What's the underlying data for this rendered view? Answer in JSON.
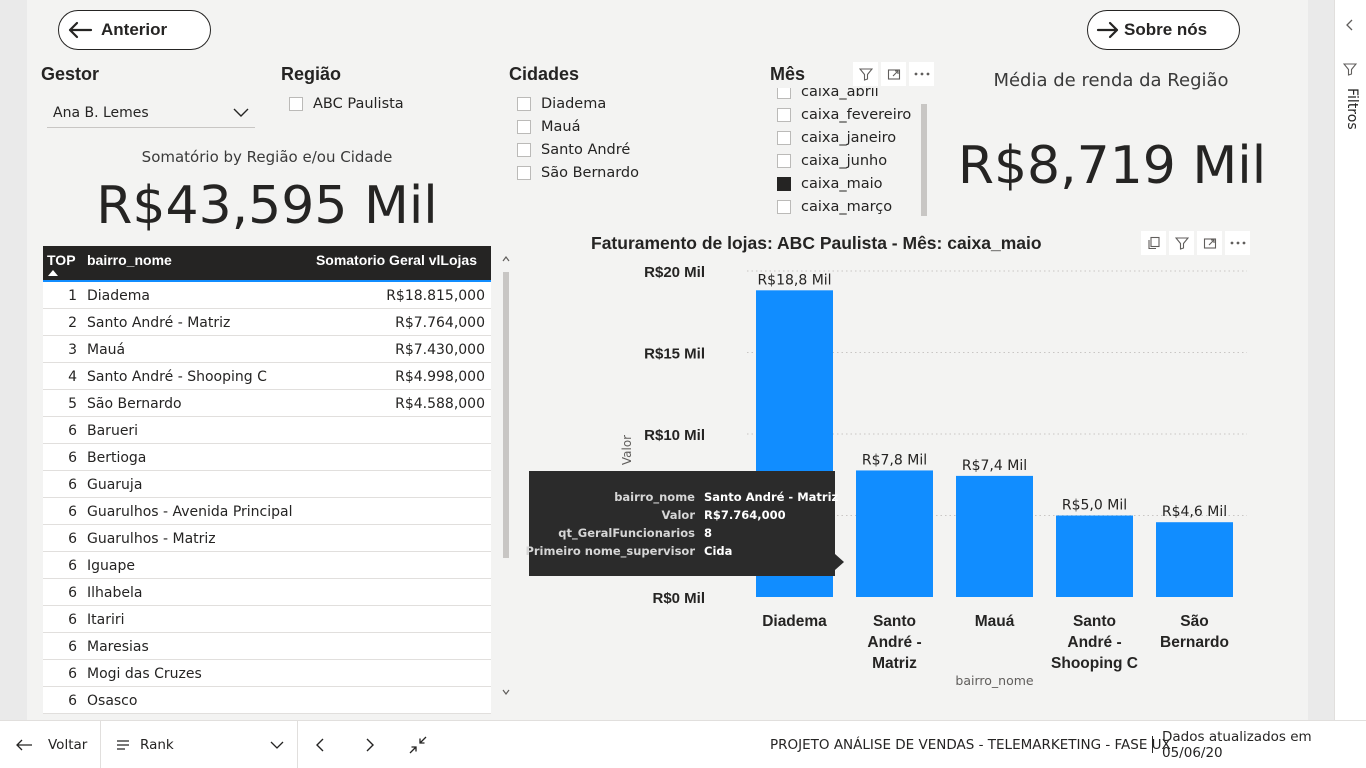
{
  "nav": {
    "back_label": "Anterior",
    "about_label": "Sobre nós"
  },
  "gestor": {
    "title": "Gestor",
    "selected": "Ana B. Lemes"
  },
  "regiao": {
    "title": "Região",
    "options": [
      {
        "label": "ABC Paulista",
        "checked": false
      }
    ]
  },
  "cidades": {
    "title": "Cidades",
    "options": [
      {
        "label": "Diadema",
        "checked": false
      },
      {
        "label": "Mauá",
        "checked": false
      },
      {
        "label": "Santo André",
        "checked": false
      },
      {
        "label": "São Bernardo",
        "checked": false
      }
    ]
  },
  "mes": {
    "title": "Mês",
    "options": [
      {
        "label": "caixa_abril",
        "checked": false
      },
      {
        "label": "caixa_fevereiro",
        "checked": false
      },
      {
        "label": "caixa_janeiro",
        "checked": false
      },
      {
        "label": "caixa_junho",
        "checked": false
      },
      {
        "label": "caixa_maio",
        "checked": true
      },
      {
        "label": "caixa_março",
        "checked": false
      }
    ]
  },
  "cards": {
    "soma": {
      "label": "Somatório by Região e/ou Cidade",
      "value": "R$43,595 Mil"
    },
    "media": {
      "label": "Média de renda da Região",
      "value": "R$8,719 Mil"
    }
  },
  "table": {
    "headers": {
      "top": "TOP",
      "nome": "bairro_nome",
      "valor": "Somatorio Geral vlLojas"
    },
    "rows": [
      {
        "top": "1",
        "nome": "Diadema",
        "valor": "R$18.815,000"
      },
      {
        "top": "2",
        "nome": "Santo André - Matriz",
        "valor": "R$7.764,000"
      },
      {
        "top": "3",
        "nome": "Mauá",
        "valor": "R$7.430,000"
      },
      {
        "top": "4",
        "nome": "Santo André - Shooping C",
        "valor": "R$4.998,000"
      },
      {
        "top": "5",
        "nome": "São Bernardo",
        "valor": "R$4.588,000"
      },
      {
        "top": "6",
        "nome": "Barueri",
        "valor": ""
      },
      {
        "top": "6",
        "nome": "Bertioga",
        "valor": ""
      },
      {
        "top": "6",
        "nome": "Guaruja",
        "valor": ""
      },
      {
        "top": "6",
        "nome": "Guarulhos - Avenida Principal",
        "valor": ""
      },
      {
        "top": "6",
        "nome": "Guarulhos - Matriz",
        "valor": ""
      },
      {
        "top": "6",
        "nome": "Iguape",
        "valor": ""
      },
      {
        "top": "6",
        "nome": "Ilhabela",
        "valor": ""
      },
      {
        "top": "6",
        "nome": "Itariri",
        "valor": ""
      },
      {
        "top": "6",
        "nome": "Maresias",
        "valor": ""
      },
      {
        "top": "6",
        "nome": "Mogi das Cruzes",
        "valor": ""
      },
      {
        "top": "6",
        "nome": "Osasco",
        "valor": ""
      }
    ]
  },
  "chart_data": {
    "type": "bar",
    "title": "Faturamento de lojas: ABC Paulista - Mês: caixa_maio",
    "xlabel": "bairro_nome",
    "ylabel": "Valor",
    "ylim": [
      0,
      20
    ],
    "yticks": [
      {
        "value": 0,
        "label": "R$0 Mil"
      },
      {
        "value": 5,
        "label": ""
      },
      {
        "value": 10,
        "label": "R$10 Mil"
      },
      {
        "value": 15,
        "label": "R$15 Mil"
      },
      {
        "value": 20,
        "label": "R$20 Mil"
      }
    ],
    "grid": true,
    "bar_color": "#118dff",
    "categories": [
      "Diadema",
      "Santo André - Matriz",
      "Mauá",
      "Santo André - Shooping C",
      "São Bernardo"
    ],
    "category_lines": [
      [
        "Diadema"
      ],
      [
        "Santo",
        "André -",
        "Matriz"
      ],
      [
        "Mauá"
      ],
      [
        "Santo",
        "André -",
        "Shooping C"
      ],
      [
        "São",
        "Bernardo"
      ]
    ],
    "values": [
      18.815,
      7.764,
      7.43,
      4.998,
      4.588
    ],
    "data_labels": [
      "R$18,8 Mil",
      "R$7,8 Mil",
      "R$7,4 Mil",
      "R$5,0 Mil",
      "R$4,6 Mil"
    ]
  },
  "tooltip": {
    "rows": [
      {
        "key": "bairro_nome",
        "value": "Santo André - Matriz"
      },
      {
        "key": "Valor",
        "value": "R$7.764,000"
      },
      {
        "key": "qt_GeralFuncionarios",
        "value": "8"
      },
      {
        "key": "Primeiro nome_supervisor",
        "value": "Cida"
      }
    ]
  },
  "statusbar": {
    "back_label": "Voltar",
    "page_label": "Rank",
    "footer_text": "PROJETO ANÁLISE DE VENDAS - TELEMARKETING - FASE UX",
    "updated_text": "Dados atualizados em 05/06/20"
  },
  "right_pane": {
    "filters_label": "Filtros"
  }
}
